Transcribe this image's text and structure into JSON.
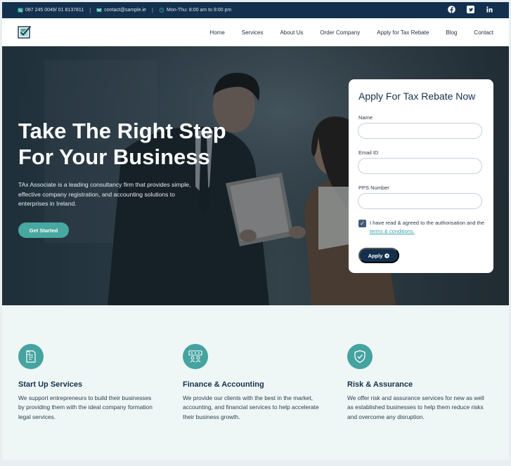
{
  "topbar": {
    "phone": "087 245 0049/ 01 8137811",
    "email": "contact@sample.ie",
    "hours": "Mon-Thu: 8:00 am to 9:00 pm",
    "separator": "|"
  },
  "socials": [
    "facebook-icon",
    "twitter-icon",
    "linkedin-icon"
  ],
  "nav": {
    "items": [
      "Home",
      "Services",
      "About Us",
      "Order Company",
      "Apply for Tax Rebate",
      "Blog",
      "Contact"
    ]
  },
  "hero": {
    "title_line1": "Take The Right Step",
    "title_line2": "For Your Business",
    "description": "TAx Associate is a leading consultancy firm that provides simple, effective company registration, and accounting solutions to enterprises in Ireland.",
    "cta_label": "Get Started"
  },
  "form": {
    "title": "Apply For Tax Rebate Now",
    "name_label": "Name",
    "email_label": "Email ID",
    "pps_label": "PPS Number",
    "name_value": "",
    "email_value": "",
    "pps_value": "",
    "agree_text": "I have read & agreed to the authorisation and the ",
    "terms_link": "terms & conditions.",
    "agree_checked": true,
    "submit_label": "Apply"
  },
  "services": [
    {
      "icon": "document-icon",
      "title": "Start Up Services",
      "description": "We support entrepreneurs to build their businesses by providing them with the ideal company formation legal services."
    },
    {
      "icon": "accounting-icon",
      "title": "Finance & Accounting",
      "description": "We provide our clients with the best in the market, accounting, and financial services to help accelerate their business growth."
    },
    {
      "icon": "shield-icon",
      "title": "Risk & Assurance",
      "description": "We offer risk and assurance services for new as well as established businesses to help them reduce risks and overcome any disruption."
    }
  ],
  "colors": {
    "navy": "#13314e",
    "teal": "#47a7a1",
    "link": "#3aa3b1",
    "section_bg": "#eff7f6"
  }
}
